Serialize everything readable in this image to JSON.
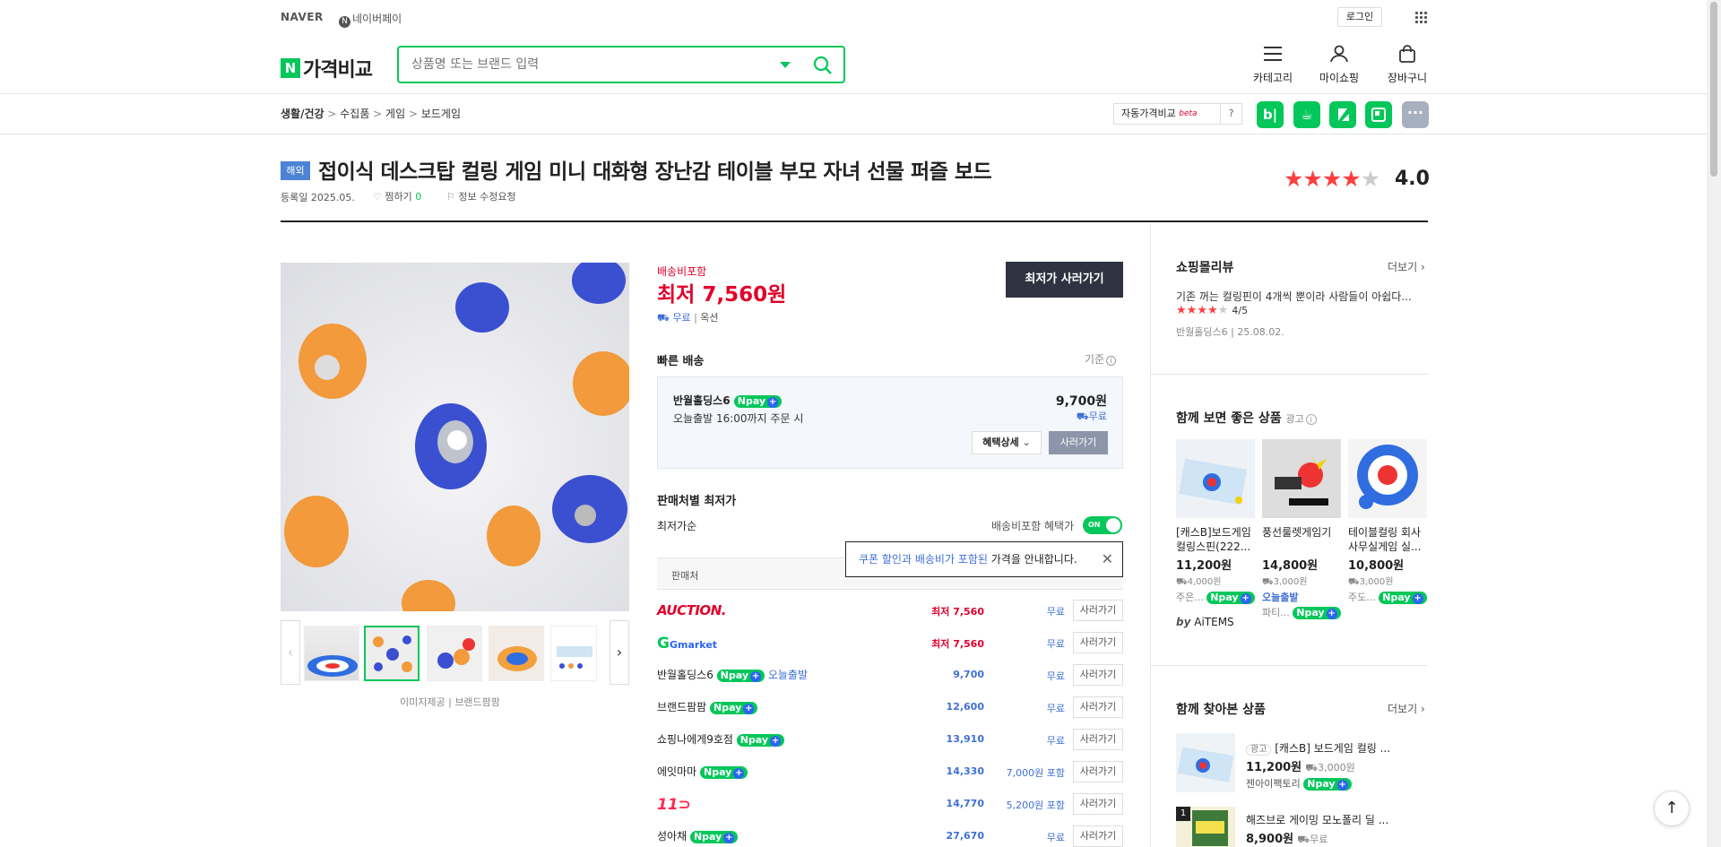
{
  "topbar": {
    "naver": "NAVER",
    "npay": "네이버페이",
    "login": "로그인"
  },
  "header": {
    "logo_n": "N",
    "logo_text": "가격비교",
    "search_placeholder": "상품명 또는 브랜드 입력",
    "categories": "카테고리",
    "myshopping": "마이쇼핑",
    "cart": "장바구니"
  },
  "breadcrumb": [
    "생활/건강",
    "수집품",
    "게임",
    "보드게임"
  ],
  "auto_compare": {
    "label": "자동가격비교",
    "beta": "beta",
    "help": "?"
  },
  "product": {
    "badge": "해외",
    "title": "접이식 데스크탑 컬링 게임 미니 대화형 장난감 테이블 부모 자녀 선물 퍼즐 보드",
    "registered": "등록일 2025.05.",
    "wish_label": "찜하기",
    "wish_count": "0",
    "report": "정보 수정요청",
    "rating": "4.0",
    "rating_value": 4
  },
  "gallery": {
    "caption_1": "이미지제공",
    "caption_2": "브랜드팜팜"
  },
  "price": {
    "shipping_included": "배송비포함",
    "lowest_label": "최저",
    "lowest_price": "7,560원",
    "free": "무료",
    "option": "옥션",
    "buy_lowest": "최저가 사러가기"
  },
  "fast_delivery": {
    "title": "빠른 배송",
    "basis": "기준",
    "seller": "반월홀딩스6",
    "npay": "pay",
    "today": "오늘출발 16:00까지 주문 시",
    "price": "9,700원",
    "ship": "무료",
    "benefit": "혜택상세",
    "buy": "사러가기"
  },
  "seller_lowest": {
    "title": "판매처별 최저가",
    "sort": "최저가순",
    "toggle_label": "배송비포함 혜택가",
    "toggle": "ON",
    "tooltip_1": "쿠폰 할인과 배송비가 포함된",
    "tooltip_2": " 가격을 안내합니다.",
    "col_seller": "판매처"
  },
  "sellers": [
    {
      "name": "AUCTION.",
      "type": "auction",
      "price": "최저 7,560",
      "ship": "무료",
      "buy": "사러가기",
      "red": true
    },
    {
      "name": "Gmarket",
      "type": "gmarket",
      "price": "최저 7,560",
      "ship": "무료",
      "buy": "사러가기",
      "red": true
    },
    {
      "name": "반월홀딩스6",
      "type": "text",
      "npay": true,
      "extra": "오늘출발",
      "price": "9,700",
      "ship": "무료",
      "buy": "사러가기"
    },
    {
      "name": "브랜드팜팜",
      "type": "text",
      "npay": true,
      "price": "12,600",
      "ship": "무료",
      "buy": "사러가기"
    },
    {
      "name": "쇼핑나에게9호점",
      "type": "text",
      "npay": true,
      "price": "13,910",
      "ship": "무료",
      "buy": "사러가기"
    },
    {
      "name": "에잇마마",
      "type": "text",
      "npay": true,
      "price": "14,330",
      "ship": "7,000원 포함",
      "buy": "사러가기"
    },
    {
      "name": "11",
      "type": "st11",
      "price": "14,770",
      "ship": "5,200원 포함",
      "buy": "사러가기"
    },
    {
      "name": "성아채",
      "type": "text",
      "npay": true,
      "price": "27,670",
      "ship": "무료",
      "buy": "사러가기"
    }
  ],
  "review": {
    "title": "쇼핑몰리뷰",
    "more": "더보기",
    "text": "기존 꺼는 컬링핀이 4개씩 뿐이라 사람들이 아쉽다...",
    "score": "4/5",
    "score_value": 4,
    "author": "반월홀딩스6",
    "date": "25.08.02."
  },
  "recommend": {
    "title": "함께 보면 좋은 상품",
    "ad": "광고",
    "items": [
      {
        "name": "[캐스B]보드게임 컬링스핀(222...",
        "price": "11,200원",
        "ship": "4,000원",
        "seller": "주은..."
      },
      {
        "name": "풍선룰렛게임기",
        "price": "14,800원",
        "ship": "3,000원",
        "extra": "오늘출발",
        "seller": "파티..."
      },
      {
        "name": "테이블컬링 회사 사무실게임 실...",
        "price": "10,800원",
        "ship": "3,000원",
        "seller": "주도..."
      }
    ],
    "by": "by",
    "aitems": "AiTEMS"
  },
  "together": {
    "title": "함께 찾아본 상품",
    "more": "더보기",
    "items": [
      {
        "ad": "광고",
        "name": "[캐스B] 보드게임 컬링 ...",
        "price": "11,200원",
        "ship": "3,000원",
        "seller": "젠아이팩토리"
      },
      {
        "rank": "1",
        "name": "해즈브로 게이밍 모노폴리 딜 ...",
        "price": "8,900원",
        "ship": "무료"
      }
    ]
  },
  "colors": {
    "green": "#03c75a",
    "red": "#e0002a",
    "blue": "#3f6fd5",
    "dark": "#2d3340"
  }
}
